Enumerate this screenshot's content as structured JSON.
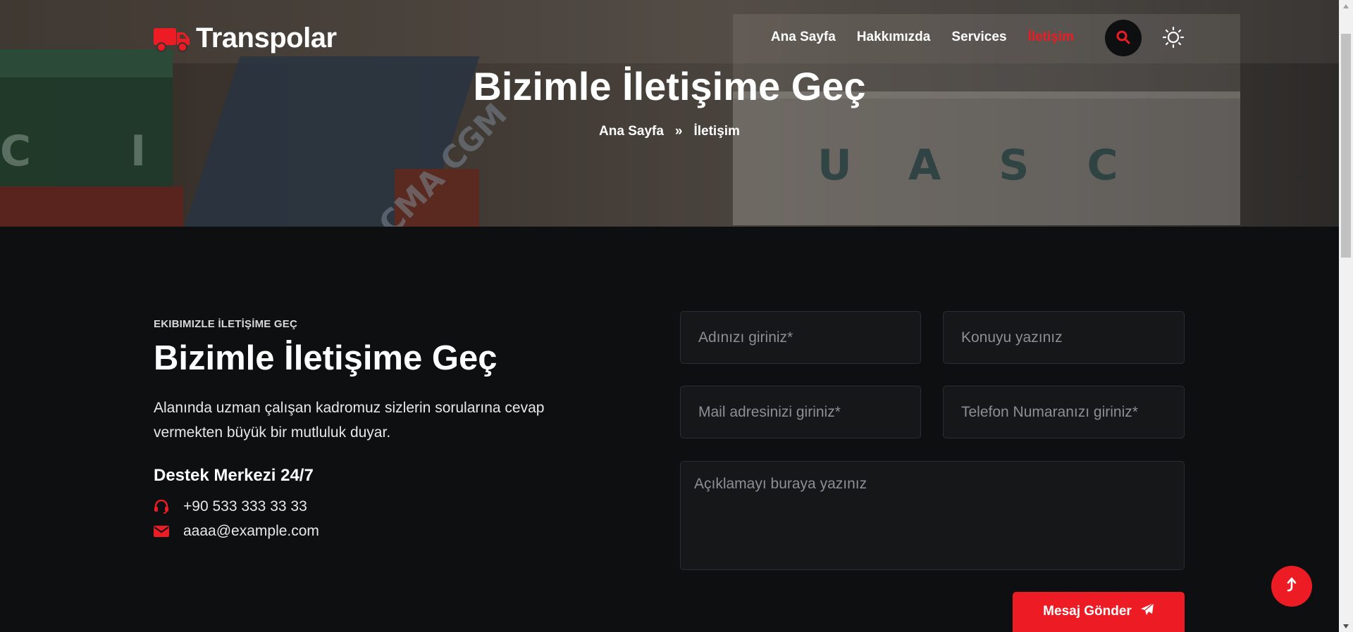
{
  "brand": {
    "name": "Transpolar",
    "accent": "#ed1c24"
  },
  "nav": {
    "items": [
      {
        "label": "Ana Sayfa"
      },
      {
        "label": "Hakkımızda"
      },
      {
        "label": "Services"
      },
      {
        "label": "İletişim",
        "active": true
      }
    ]
  },
  "hero": {
    "title": "Bizimle İletişime Geç",
    "breadcrumb": {
      "home": "Ana Sayfa",
      "separator": "»",
      "current": "İletişim"
    }
  },
  "contact": {
    "eyebrow": "EKIBIMIZLE İLETİŞİME GEÇ",
    "title": "Bizimle İletişime Geç",
    "description": "Alanında uzman çalışan kadromuz sizlerin sorularına cevap vermekten büyük bir mutluluk duyar.",
    "support_title": "Destek Merkezi 24/7",
    "phone": "+90 533 333 33 33",
    "email": "aaaa@example.com"
  },
  "form": {
    "name_placeholder": "Adınızı giriniz*",
    "subject_placeholder": "Konuyu yazınız",
    "email_placeholder": "Mail adresinizi giriniz*",
    "phone_placeholder": "Telefon Numaranızı giriniz*",
    "message_placeholder": "Açıklamayı buraya yazınız",
    "submit_label": "Mesaj Gönder"
  },
  "icons": {
    "logo": "truck-icon",
    "search": "search-icon",
    "theme": "sun-icon",
    "phone": "headset-icon",
    "email": "envelope-icon",
    "submit": "paper-plane-icon",
    "to_top": "arrow-up-icon"
  }
}
